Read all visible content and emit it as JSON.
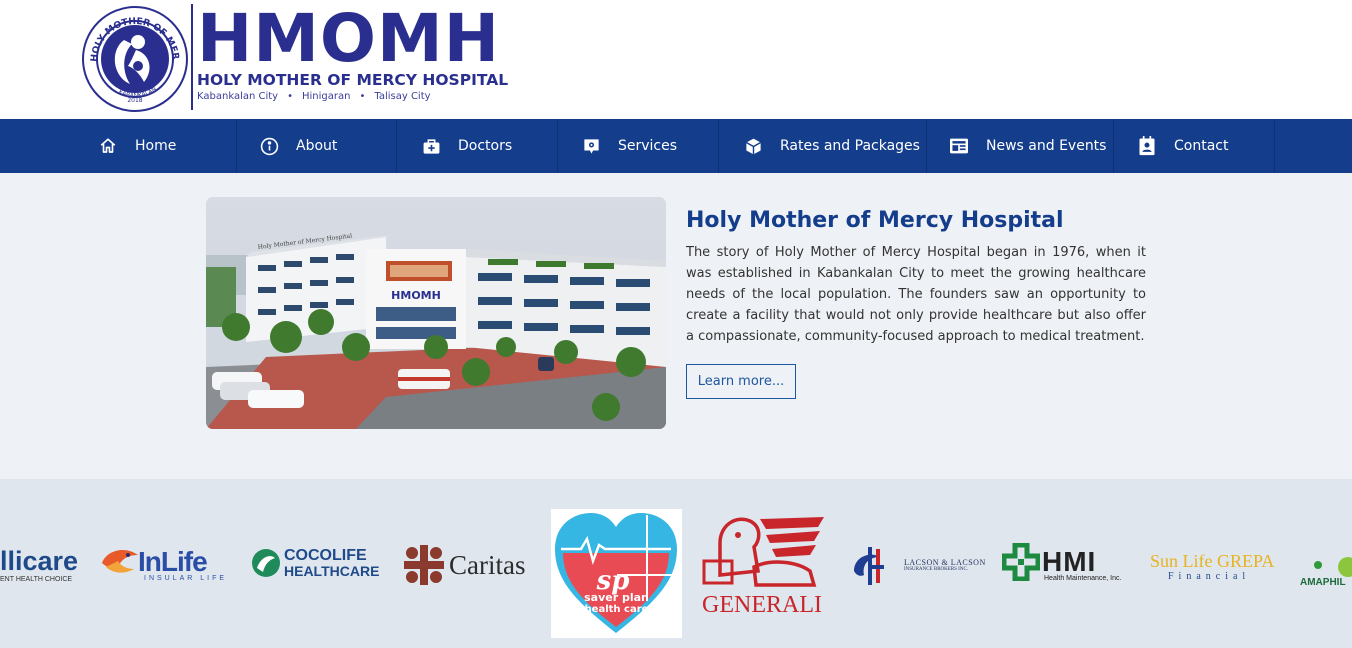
{
  "header": {
    "brand": "HMOMH",
    "brand_full": "HOLY MOTHER OF MERCY HOSPITAL",
    "locations": [
      "Kabankalan City",
      "Hinigaran",
      "Talisay City"
    ],
    "seal": {
      "ring_text": "HOLY MOTHER OF MERCY HOSPITAL",
      "city": "KABANKALAN",
      "year": "2018"
    }
  },
  "nav": {
    "items": [
      {
        "label": "Home",
        "icon": "home-icon"
      },
      {
        "label": "About",
        "icon": "info-icon"
      },
      {
        "label": "Doctors",
        "icon": "medical-bag-icon"
      },
      {
        "label": "Services",
        "icon": "services-icon"
      },
      {
        "label": "Rates and Packages",
        "icon": "package-icon"
      },
      {
        "label": "News and Events",
        "icon": "newspaper-icon"
      },
      {
        "label": "Contact",
        "icon": "contact-icon"
      }
    ]
  },
  "about": {
    "title": "Holy Mother of Mercy Hospital",
    "body": "The story of Holy Mother of Mercy Hospital began in 1976, when it was established in Kabankalan City to meet the growing healthcare needs of the local population. The founders saw an opportunity to create a facility that would not only provide healthcare but also offer a compassionate, community-focused approach to medical treatment.",
    "learn_more": "Learn more...",
    "photo_signs": {
      "roof": "Holy Mother of Mercy Hospital",
      "front": "HMOMH"
    }
  },
  "partners": {
    "intellicare": {
      "name": "llicare",
      "tag": "ENT HEALTH CHOICE"
    },
    "inlife": {
      "name": "InLife",
      "tag": "INSULAR LIFE"
    },
    "cocolife": {
      "line1": "COCOLIFE",
      "line2": "HEALTHCARE"
    },
    "caritas": {
      "name": "Caritas"
    },
    "saverplan": {
      "line1": "saver plan",
      "line2": "health care"
    },
    "generali": {
      "name": "GENERALI"
    },
    "lacson": {
      "line1": "LACSON & LACSON",
      "line2": "INSURANCE BROKERS INC."
    },
    "hmi": {
      "name": "HMI",
      "tag": "Health Maintenance, Inc."
    },
    "sunlife": {
      "name": "Sun Life GREPA",
      "tag": "Financial"
    },
    "amaphil": {
      "name": "AMAPHIL"
    }
  },
  "colors": {
    "brand_blue": "#2a2f8f",
    "nav_blue": "#143d8c",
    "section_bg": "#eef1f5",
    "partners_bg": "#dfe6ee"
  }
}
